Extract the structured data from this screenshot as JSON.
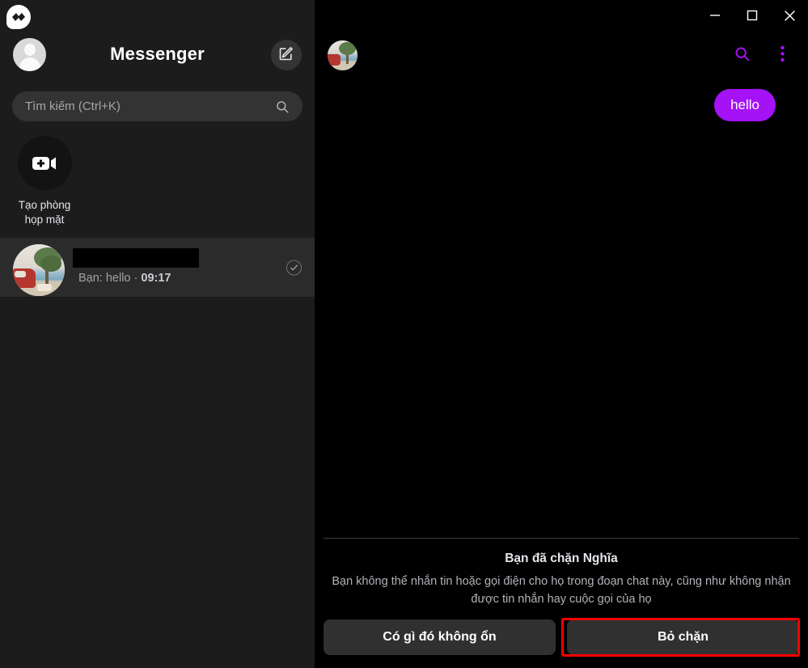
{
  "app": {
    "name": "Messenger",
    "logo_icon": "messenger-logo-icon"
  },
  "window_controls": {
    "minimize": "–",
    "maximize": "□",
    "close": "✕"
  },
  "sidebar": {
    "title": "Messenger",
    "profile_avatar_icon": "person-avatar-icon",
    "compose_icon": "compose-new-message-icon",
    "search": {
      "placeholder": "Tìm kiếm (Ctrl+K)",
      "value": "",
      "icon": "search-icon"
    },
    "create_room": {
      "icon": "video-camera-plus-icon",
      "label_line1": "Tạo phòng",
      "label_line2": "họp mặt"
    },
    "chats": [
      {
        "name": "",
        "name_redacted": true,
        "avatar_icon": "beach-photo-avatar",
        "preview": "Bạn: hello",
        "separator": "·",
        "time": "09:17",
        "status_icon": "seen-check-icon",
        "selected": true
      }
    ]
  },
  "chat": {
    "title": "",
    "avatar_icon": "beach-photo-avatar",
    "search_icon": "search-icon",
    "menu_icon": "more-options-icon",
    "accent_color": "#a512f5",
    "messages": [
      {
        "text": "hello",
        "direction": "outgoing"
      }
    ],
    "blocked": {
      "title": "Bạn đã chặn Nghĩa",
      "description": "Bạn không thể nhắn tin hoặc gọi điện cho họ trong đoạn chat này, cũng như không nhận được tin nhắn hay cuộc gọi của họ",
      "report_button": "Có gì đó không ổn",
      "unblock_button": "Bỏ chặn"
    }
  },
  "annotation": {
    "highlight_color": "#ff0000",
    "target": "unblock-button"
  }
}
